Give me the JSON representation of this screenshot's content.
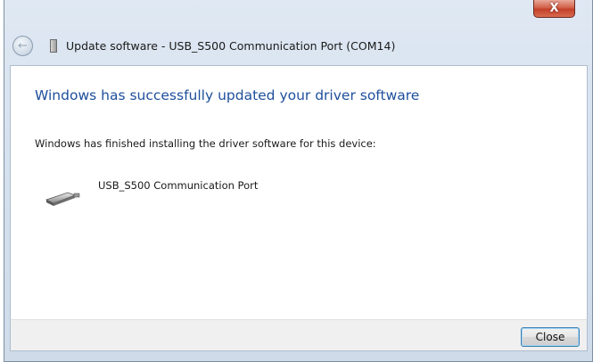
{
  "window": {
    "title": "Update software - USB_S500 Communication Port (COM14)",
    "close_glyph": "X"
  },
  "nav": {
    "back_icon": "back-arrow-icon"
  },
  "content": {
    "heading": "Windows has successfully updated your driver software",
    "description": "Windows has finished installing the driver software for this device:",
    "device_name": "USB_S500 Communication Port",
    "device_icon": "serial-port-icon"
  },
  "footer": {
    "close_label": "Close"
  },
  "colors": {
    "heading": "#1e4f9c",
    "close_button_red": "#c4402a",
    "button_focus_border": "#3c7fb1"
  }
}
